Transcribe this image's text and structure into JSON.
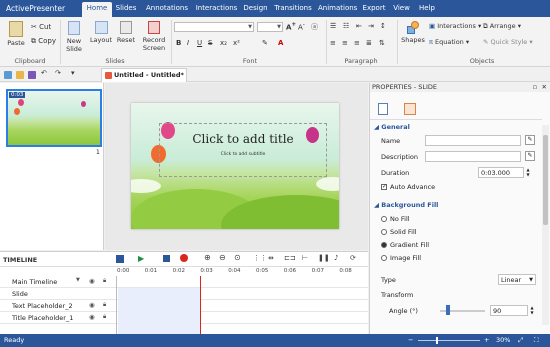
{
  "app_button": "ActivePresenter",
  "tabs": [
    "Home",
    "Slides",
    "Annotations",
    "Interactions",
    "Design",
    "Transitions",
    "Animations",
    "Export",
    "View",
    "Help"
  ],
  "active_tab": "Home",
  "ribbon": {
    "clipboard": {
      "paste": "Paste",
      "cut": "Cut",
      "copy": "Copy",
      "group": "Clipboard"
    },
    "slides": {
      "new_slide": "New Slide",
      "layout": "Layout",
      "reset": "Reset",
      "record": "Record Screen",
      "group": "Slides"
    },
    "font_group": "Font",
    "paragraph_group": "Paragraph",
    "objects": {
      "shapes": "Shapes",
      "interactions": "Interactions",
      "equation": "Equation",
      "arrange": "Arrange",
      "quick_style": "Quick Style",
      "group": "Objects"
    }
  },
  "doc_tab": "Untitled - Untitled*",
  "thumbnail": {
    "label": "0:03",
    "number": "1"
  },
  "slide": {
    "title_placeholder": "Click to add title",
    "subtitle_placeholder": "Click to add subtitle"
  },
  "properties": {
    "header": "PROPERTIES - SLIDE",
    "general": "General",
    "name_label": "Name",
    "description_label": "Description",
    "duration_label": "Duration",
    "duration_value": "0:03.000",
    "auto_advance": "Auto Advance",
    "background_fill": "Background Fill",
    "fill_options": [
      "No Fill",
      "Solid Fill",
      "Gradient Fill",
      "Image Fill"
    ],
    "selected_fill": "Gradient Fill",
    "type_label": "Type",
    "type_value": "Linear",
    "transform_label": "Transform",
    "angle_label": "Angle (°)",
    "angle_value": "90"
  },
  "timeline": {
    "header": "TIMELINE",
    "rows": [
      "Main Timeline",
      "Slide",
      "Text Placeholder_2",
      "Title Placeholder_1"
    ],
    "ticks": [
      "0:00",
      "0:01",
      "0:02",
      "0:03",
      "0:04",
      "0:05",
      "0:06",
      "0:07",
      "0:08"
    ]
  },
  "status": {
    "left": "Ready",
    "zoom": "30%"
  },
  "colors": {
    "accent": "#2b579a",
    "playhead": "#d9261c"
  }
}
